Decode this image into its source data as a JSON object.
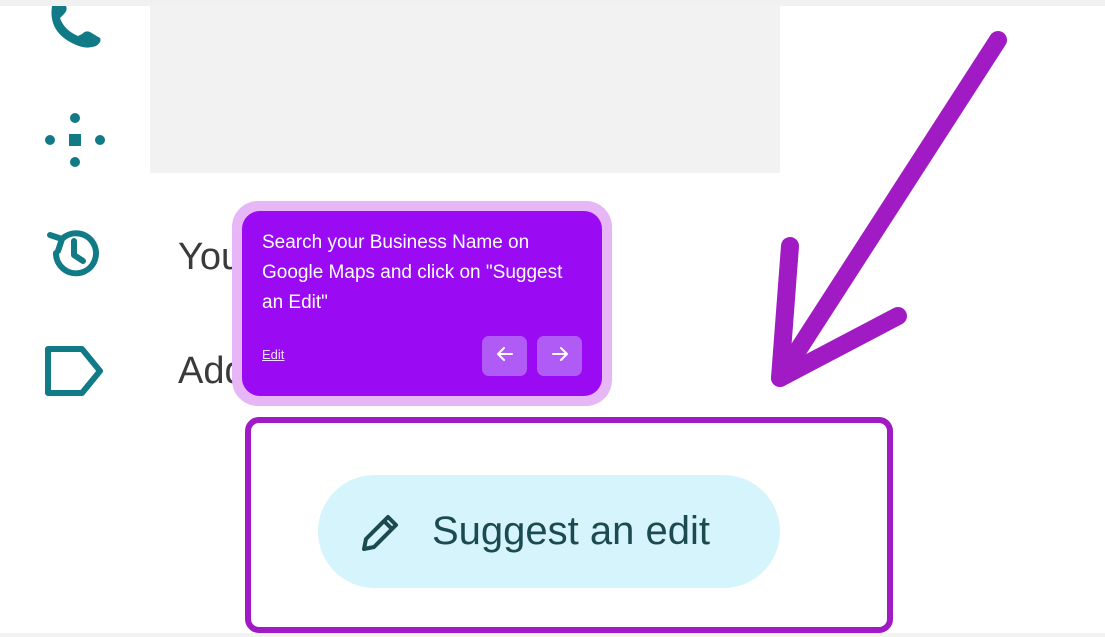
{
  "sidebar": {
    "rows": [
      {
        "icon": "phone-icon"
      },
      {
        "icon": "dots-grid-icon"
      },
      {
        "icon": "history-icon",
        "label": "You"
      },
      {
        "icon": "label-tag-icon",
        "label": "Add"
      }
    ]
  },
  "tooltip": {
    "message": "Search your Business Name on Google Maps and click on \"Suggest an Edit\"",
    "edit_link": "Edit",
    "prev_icon": "arrow-left-icon",
    "next_icon": "arrow-right-icon"
  },
  "suggest_button": {
    "label": "Suggest an edit",
    "icon": "pencil-icon"
  },
  "colors": {
    "tooltip_bg": "#9a0af2",
    "highlight": "#a01bc3",
    "pill_bg": "#d6f4fb",
    "icon_teal": "#107a86"
  }
}
